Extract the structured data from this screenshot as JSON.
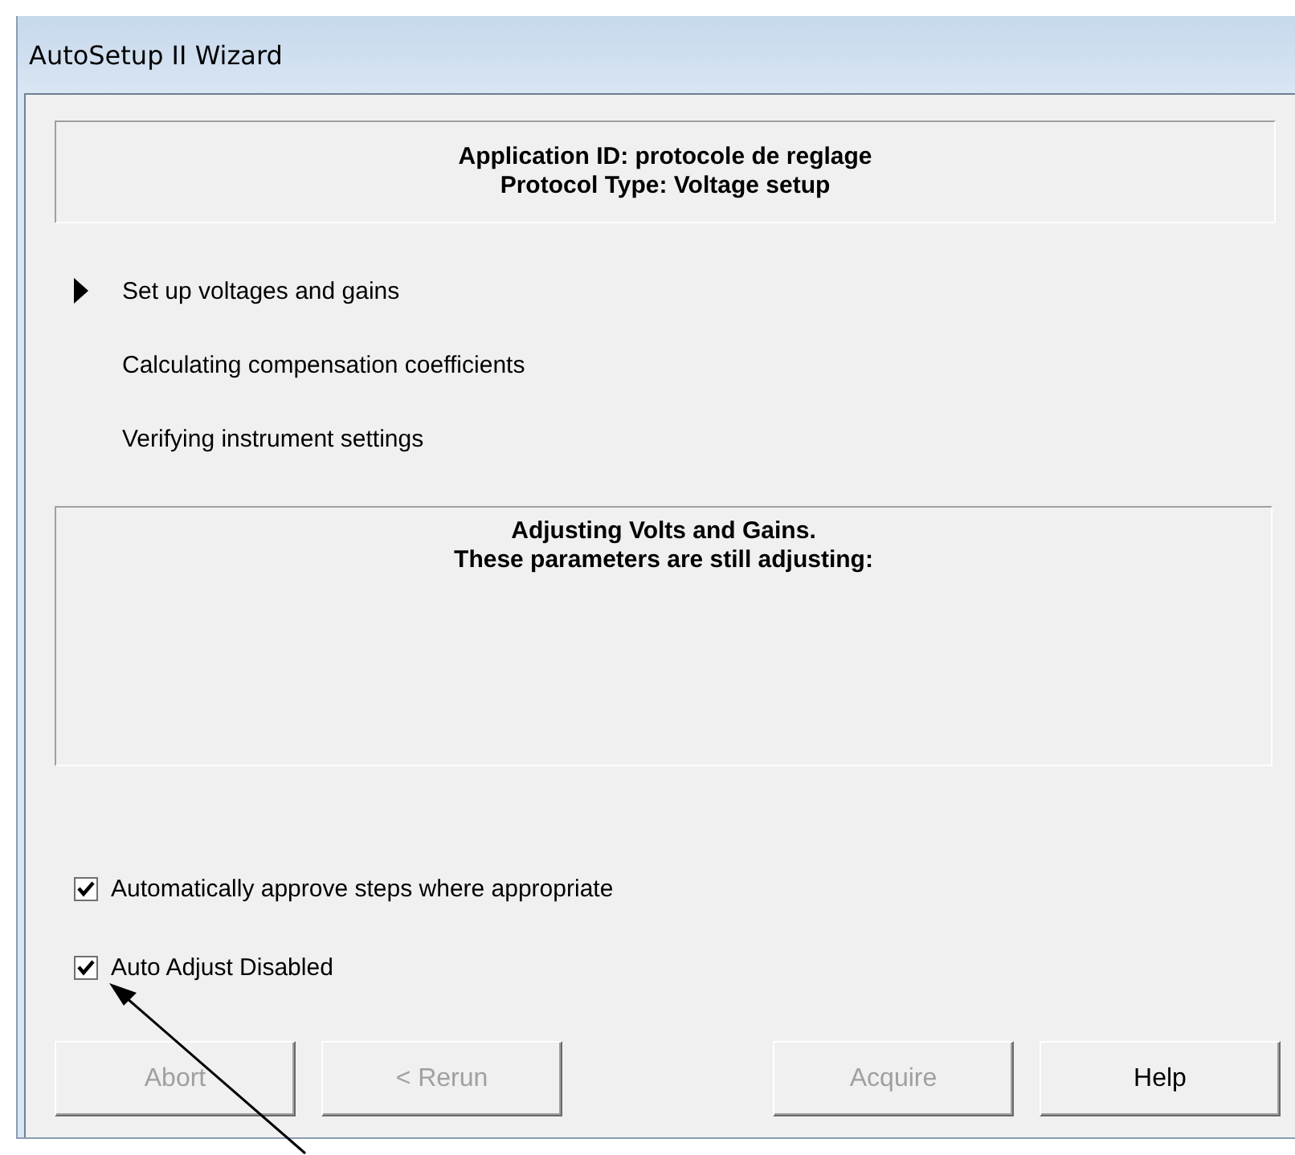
{
  "window": {
    "title": "AutoSetup II Wizard"
  },
  "header": {
    "lines": [
      "Application ID: protocole de reglage",
      "Protocol Type: Voltage setup"
    ]
  },
  "steps": [
    {
      "label": "Set up voltages and gains",
      "current": true
    },
    {
      "label": "Calculating compensation coefficients",
      "current": false
    },
    {
      "label": "Verifying instrument settings",
      "current": false
    }
  ],
  "status_panel": {
    "lines": [
      "Adjusting Volts and Gains.",
      "These parameters are still adjusting:"
    ]
  },
  "options": [
    {
      "label": "Automatically approve steps where appropriate",
      "checked": true
    },
    {
      "label": "Auto Adjust Disabled",
      "checked": true
    }
  ],
  "buttons": [
    {
      "label": "Abort",
      "disabled": true
    },
    {
      "label": "< Rerun",
      "disabled": true
    },
    {
      "label": "Acquire",
      "disabled": true
    },
    {
      "label": "Help",
      "disabled": false
    }
  ]
}
